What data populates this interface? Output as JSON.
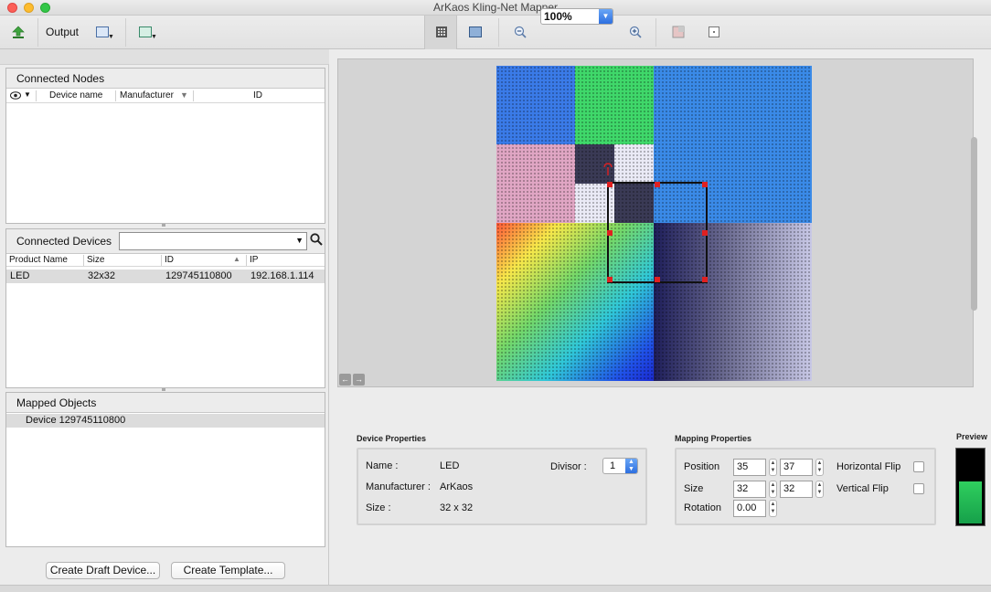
{
  "window": {
    "title": "ArKaos Kling-Net Mapper"
  },
  "toolbar": {
    "output_label": "Output",
    "zoom_value": "100%"
  },
  "connected_nodes": {
    "title": "Connected Nodes",
    "columns": [
      "Device name",
      "Manufacturer",
      "ID"
    ]
  },
  "connected_devices": {
    "title": "Connected Devices",
    "filter_value": "",
    "columns": [
      "Product Name",
      "Size",
      "ID",
      "IP"
    ],
    "rows": [
      {
        "product": "LED",
        "size": "32x32",
        "id": "129745110800",
        "ip": "192.168.1.114"
      }
    ]
  },
  "mapped_objects": {
    "title": "Mapped Objects",
    "items": [
      "Device 129745110800"
    ]
  },
  "buttons": {
    "create_draft": "Create Draft Device...",
    "create_template": "Create Template..."
  },
  "device_properties": {
    "title": "Device Properties",
    "name_label": "Name :",
    "name_value": "LED",
    "manufacturer_label": "Manufacturer :",
    "manufacturer_value": "ArKaos",
    "size_label": "Size :",
    "size_value": "32 x 32",
    "divisor_label": "Divisor :",
    "divisor_value": "1"
  },
  "mapping_properties": {
    "title": "Mapping Properties",
    "position_label": "Position",
    "position_x": "35",
    "position_y": "37",
    "size_label": "Size",
    "size_w": "32",
    "size_h": "32",
    "rotation_label": "Rotation",
    "rotation_value": "0.00",
    "hflip_label": "Horizontal Flip",
    "vflip_label": "Vertical Flip",
    "hflip_checked": false,
    "vflip_checked": false
  },
  "preview": {
    "label": "Preview"
  },
  "colors": {
    "accent": "#2d6fe0",
    "handle": "#e02020"
  }
}
